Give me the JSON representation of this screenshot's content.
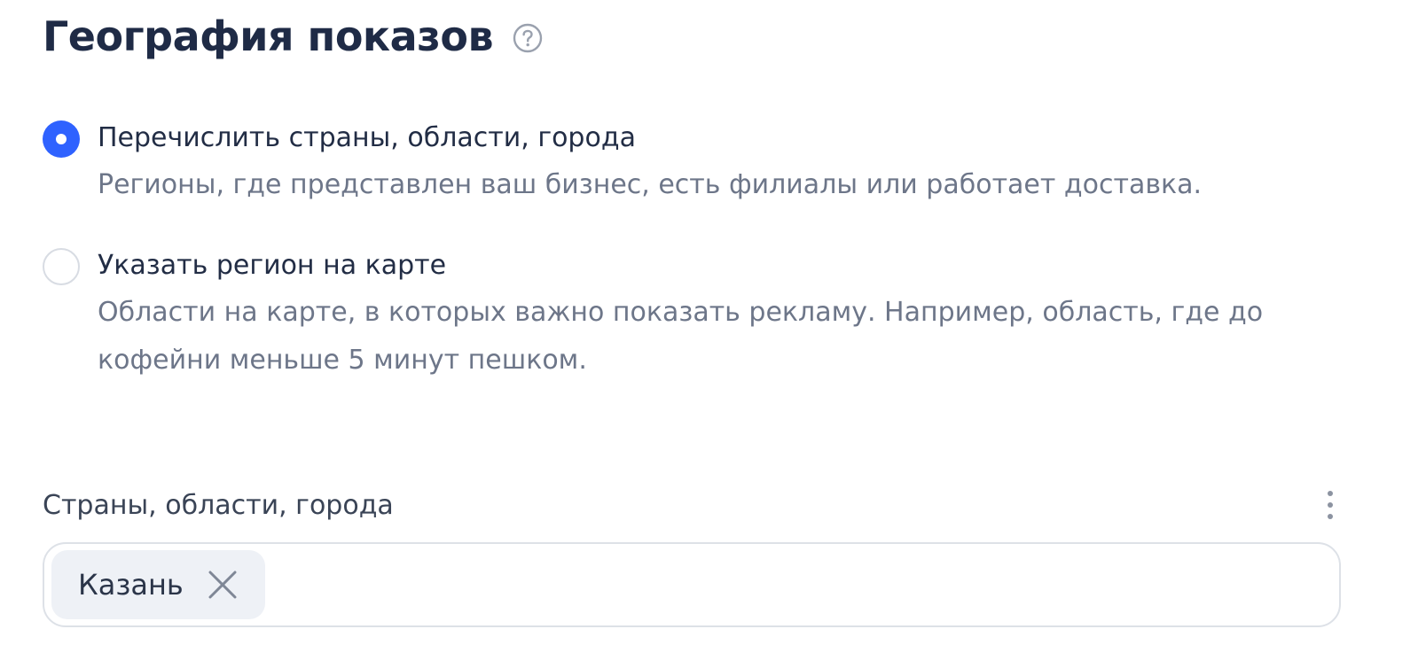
{
  "header": {
    "title": "География показов",
    "help_icon": "question-circle-icon"
  },
  "targeting_options": [
    {
      "label": "Перечислить страны, области, города",
      "description": "Регионы, где представлен ваш бизнес, есть филиалы или работает доставка.",
      "selected": true
    },
    {
      "label": "Указать регион на карте",
      "description": "Области на карте, в которых важно показать рекламу. Например, область, где до кофейни меньше 5 минут пешком.",
      "selected": false
    }
  ],
  "regions_field": {
    "label": "Страны, области, города",
    "menu_icon": "vertical-dots-icon",
    "chips": [
      {
        "label": "Казань",
        "remove_icon": "close-icon"
      }
    ]
  },
  "colors": {
    "accent": "#2f62ff",
    "title": "#1f2b46",
    "secondary_text": "#6d7689",
    "border": "#dde1e7",
    "chip_bg": "#eef1f6"
  }
}
